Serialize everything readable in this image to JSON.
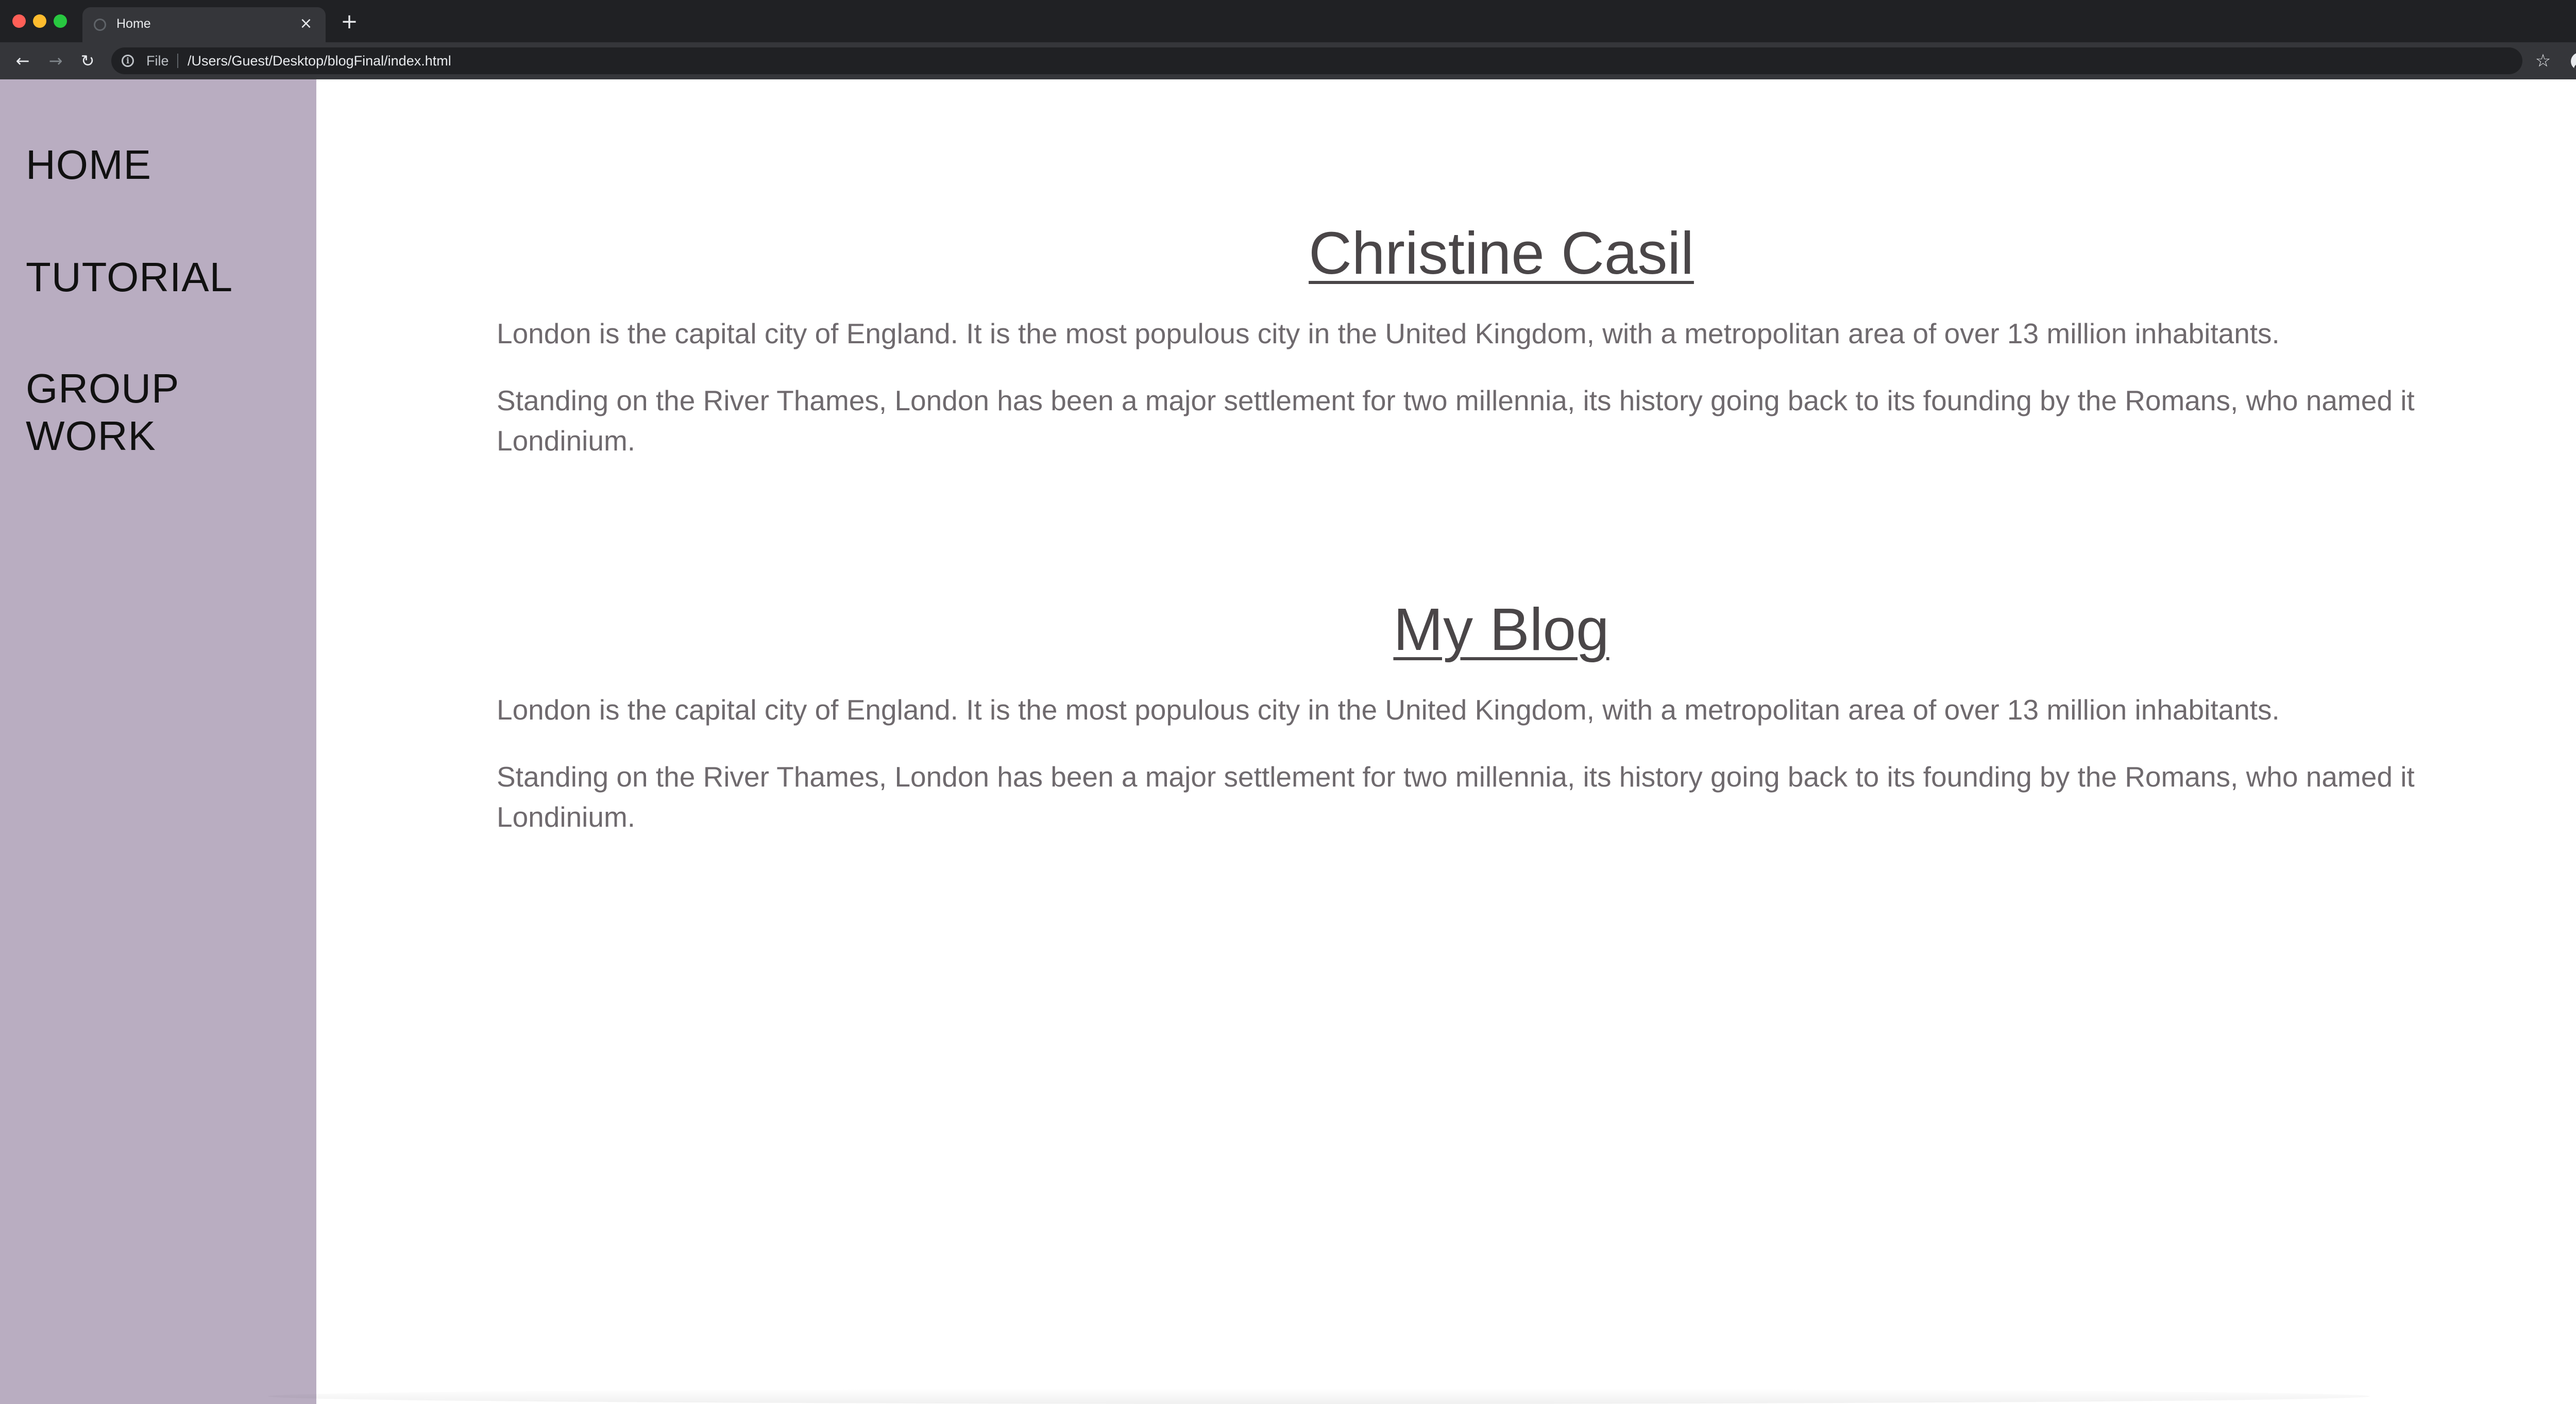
{
  "browser": {
    "tab_title": "Home",
    "tab_close": "×",
    "new_tab": "+",
    "back": "←",
    "forward": "→",
    "reload": "↻",
    "info": "i",
    "scheme_label": "File",
    "url": "/Users/Guest/Desktop/blogFinal/index.html",
    "bookmark": "☆",
    "colors": {
      "titlebar": "#202124",
      "toolbar": "#35363a",
      "omnibox": "#202124"
    }
  },
  "sidebar": {
    "background": "#b9adc1",
    "items": [
      {
        "label": "HOME"
      },
      {
        "label": "TUTORIAL"
      },
      {
        "label": "GROUP WORK"
      }
    ]
  },
  "main": {
    "sections": [
      {
        "title": "Christine Casil",
        "paragraphs": [
          "London is the capital city of England. It is the most populous city in the United Kingdom, with a metropolitan area of over 13 million inhabitants.",
          "Standing on the River Thames, London has been a major settlement for two millennia, its history going back to its founding by the Romans, who named it Londinium."
        ]
      },
      {
        "title": "My Blog",
        "paragraphs": [
          "London is the capital city of England. It is the most populous city in the United Kingdom, with a metropolitan area of over 13 million inhabitants.",
          "Standing on the River Thames, London has been a major settlement for two millennia, its history going back to its founding by the Romans, who named it Londinium."
        ]
      }
    ]
  }
}
